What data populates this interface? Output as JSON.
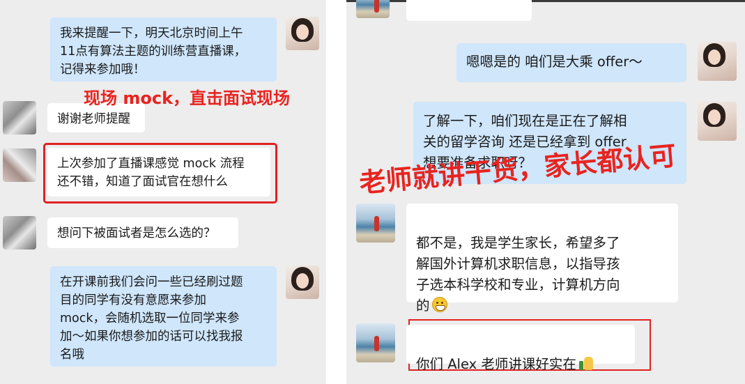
{
  "left_panel": {
    "messages": [
      {
        "text": "我来提醒一下，明天北京时间上午\n11点有算法主题的训练营直播课，\n记得来参加哦！"
      },
      {
        "text": "谢谢老师提醒"
      },
      {
        "text": "上次参加了直播课感觉 mock 流程\n还不错，知道了面试官在想什么"
      },
      {
        "text": "想问下被面试者是怎么选的？"
      },
      {
        "text": "在开课前我们会问一些已经刷过题\n目的同学有没有意愿来参加\nmock，会随机选取一位同学来参\n加～如果你想参加的话可以找我报\n名哦"
      }
    ],
    "overlay_caption": "现场 mock，直击面试现场"
  },
  "right_panel": {
    "messages": [
      {
        "text": "嗯嗯是的 咱们是大乘 offer～"
      },
      {
        "text": "了解一下，咱们现在是正在了解相\n关的留学咨询 还是已经拿到 offer\n想要准备求职呀？"
      },
      {
        "text": "都不是，我是学生家长，希望多了\n解国外计算机求职信息，以指导孩\n子选本科学校和专业，计算机方向\n的",
        "emoji": "grinning-face-emoji"
      },
      {
        "text": "你们 Alex 老师讲课好实在",
        "emoji": "thumbs-up-emoji"
      }
    ],
    "overlay_caption": "老师就讲干货，家长都认可"
  },
  "colors": {
    "chat_background": "#ededed",
    "bubble_blue": "#cfe6fb",
    "bubble_white": "#ffffff",
    "highlight_red": "#e02121",
    "overlay_red": "#e8231f"
  }
}
